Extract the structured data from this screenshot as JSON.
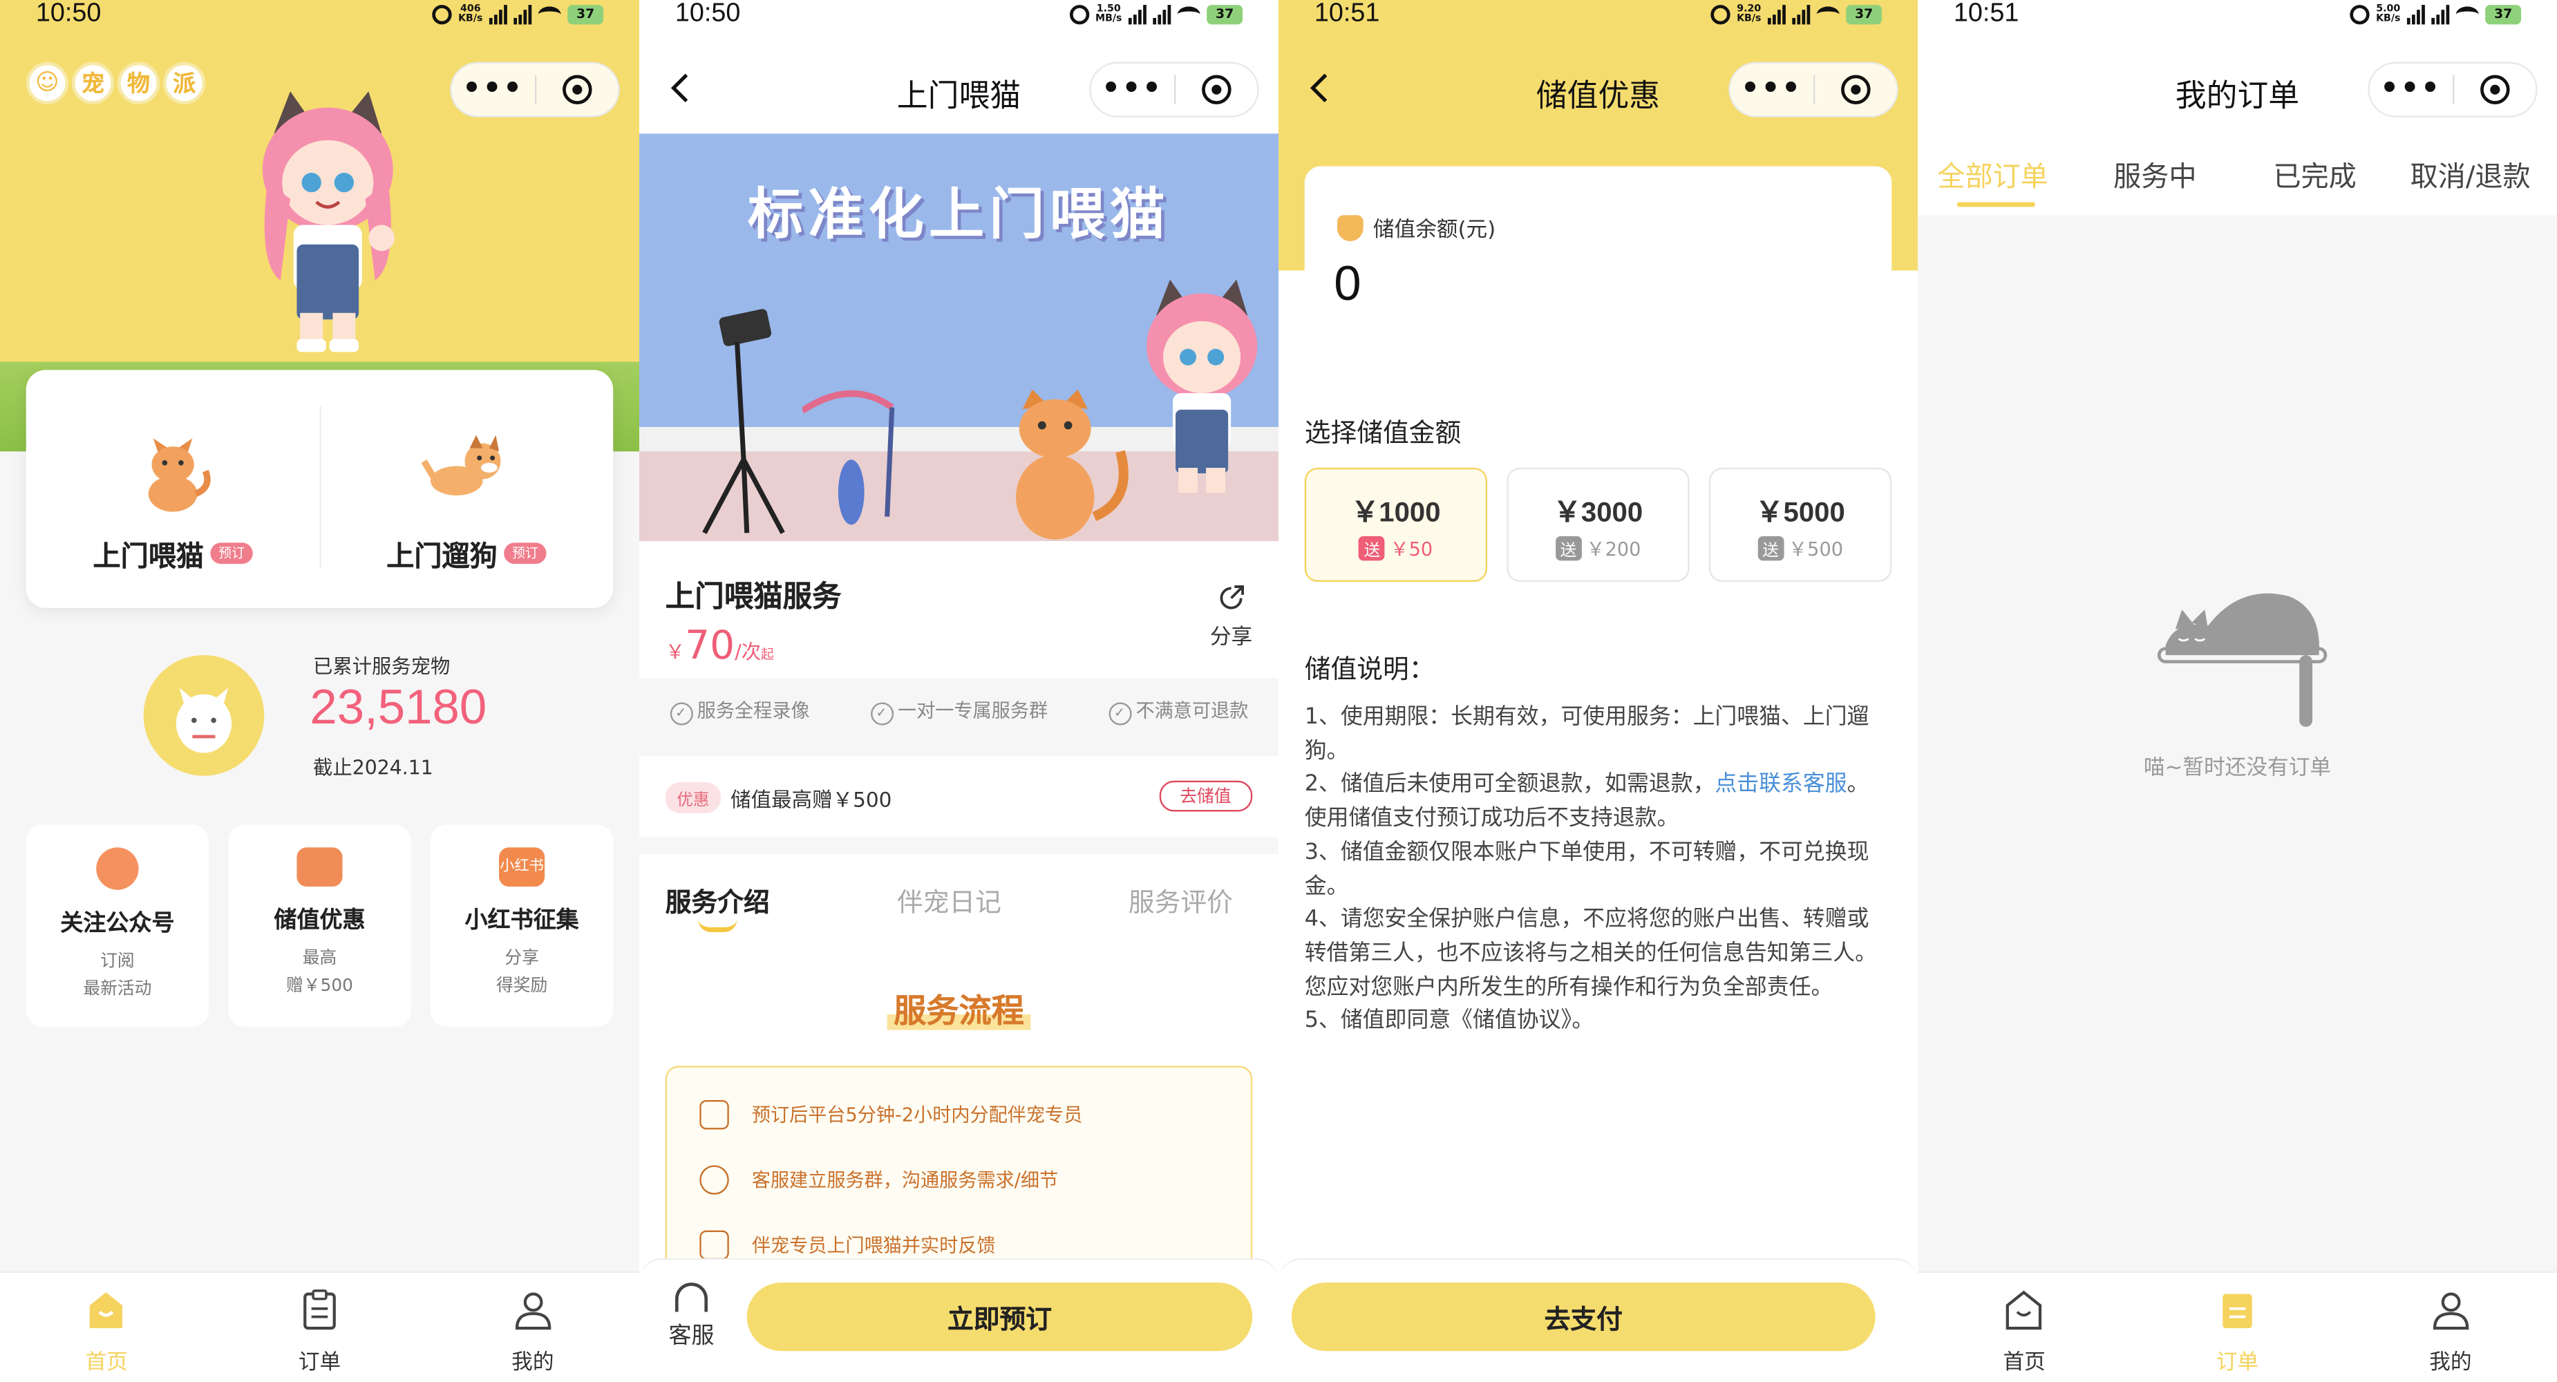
{
  "screens": {
    "home": {
      "status": {
        "time": "10:50",
        "net": "406\nKB/s",
        "sig1": "5G",
        "sig2": "5G",
        "battery": "37"
      },
      "logo_chars": [
        "宠",
        "物",
        "派"
      ],
      "services": [
        {
          "label": "上门喂猫",
          "tag": "预订"
        },
        {
          "label": "上门遛狗",
          "tag": "预订"
        }
      ],
      "stats": {
        "caption": "已累计服务宠物",
        "count": "23,5180",
        "as_of": "截止2024.11"
      },
      "promos": [
        {
          "icon_text": "",
          "title": "关注公众号",
          "sub1": "订阅",
          "sub2": "最新活动"
        },
        {
          "icon_text": "",
          "title": "储值优惠",
          "sub1": "最高",
          "sub2": "赠￥500"
        },
        {
          "icon_text": "小红书",
          "title": "小红书征集",
          "sub1": "分享",
          "sub2": "得奖励"
        }
      ],
      "tabbar": [
        {
          "label": "首页",
          "icon": "home-icon",
          "active": true
        },
        {
          "label": "订单",
          "icon": "clipboard-icon",
          "active": false
        },
        {
          "label": "我的",
          "icon": "user-icon",
          "active": false
        }
      ]
    },
    "cat_service": {
      "status": {
        "time": "10:50",
        "net": "1.50\nMB/s",
        "battery": "37"
      },
      "nav_title": "上门喂猫",
      "banner_title": "标准化上门喂猫",
      "service_name": "上门喂猫服务",
      "price_symbol": "￥",
      "price_value": "70",
      "price_unit": "/次",
      "price_suffix": "起",
      "share_label": "分享",
      "guarantees": [
        "服务全程录像",
        "一对一专属服务群",
        "不满意可退款"
      ],
      "coupon": {
        "tag": "优惠",
        "text": "储值最高赠￥500",
        "action": "去储值"
      },
      "tabs": [
        "服务介绍",
        "伴宠日记",
        "服务评价"
      ],
      "flow_title": "服务流程",
      "flow_steps": [
        "预订后平台5分钟-2小时内分配伴宠专员",
        "客服建立服务群，沟通服务需求/细节",
        "伴宠专员上门喂猫并实时反馈"
      ],
      "service_label": "客服",
      "book_label": "立即预订"
    },
    "recharge": {
      "status": {
        "time": "10:51",
        "net": "9.20\nKB/s",
        "battery": "37"
      },
      "nav_title": "储值优惠",
      "balance_label": "储值余额(元)",
      "balance": "0",
      "select_label": "选择储值金额",
      "amounts": [
        {
          "value": "￥1000",
          "gift_tag": "送",
          "gift": "￥50",
          "selected": true
        },
        {
          "value": "￥3000",
          "gift_tag": "送",
          "gift": "￥200",
          "selected": false
        },
        {
          "value": "￥5000",
          "gift_tag": "送",
          "gift": "￥500",
          "selected": false
        }
      ],
      "notes_title": "储值说明：",
      "notes": {
        "n1": "1、使用期限：长期有效，可使用服务：上门喂猫、上门遛狗。",
        "n2a": "2、储值后未使用可全额退款，如需退款，",
        "n2link": "点击联系客服",
        "n2b": "。使用储值支付预订成功后不支持退款。",
        "n3": "3、储值金额仅限本账户下单使用，不可转赠，不可兑换现金。",
        "n4": "4、请您安全保护账户信息，不应将您的账户出售、转赠或转借第三人，也不应该将与之相关的任何信息告知第三人。您应对您账户内所发生的所有操作和行为负全部责任。",
        "n5": "5、储值即同意《储值协议》。"
      },
      "pay_label": "去支付"
    },
    "orders": {
      "status": {
        "time": "10:51",
        "net": "5.00\nKB/s",
        "battery": "37"
      },
      "nav_title": "我的订单",
      "tabs": [
        "全部订单",
        "服务中",
        "已完成",
        "取消/退款"
      ],
      "empty_text": "喵~暂时还没有订单",
      "tabbar": [
        {
          "label": "首页",
          "icon": "home-icon",
          "active": false
        },
        {
          "label": "订单",
          "icon": "clipboard-icon",
          "active": true
        },
        {
          "label": "我的",
          "icon": "user-icon",
          "active": false
        }
      ]
    }
  },
  "colors": {
    "brand_yellow": "#f5dc6e",
    "accent_pink": "#ef5d76",
    "flow_orange": "#c9702a",
    "link_blue": "#4a8fd8"
  }
}
